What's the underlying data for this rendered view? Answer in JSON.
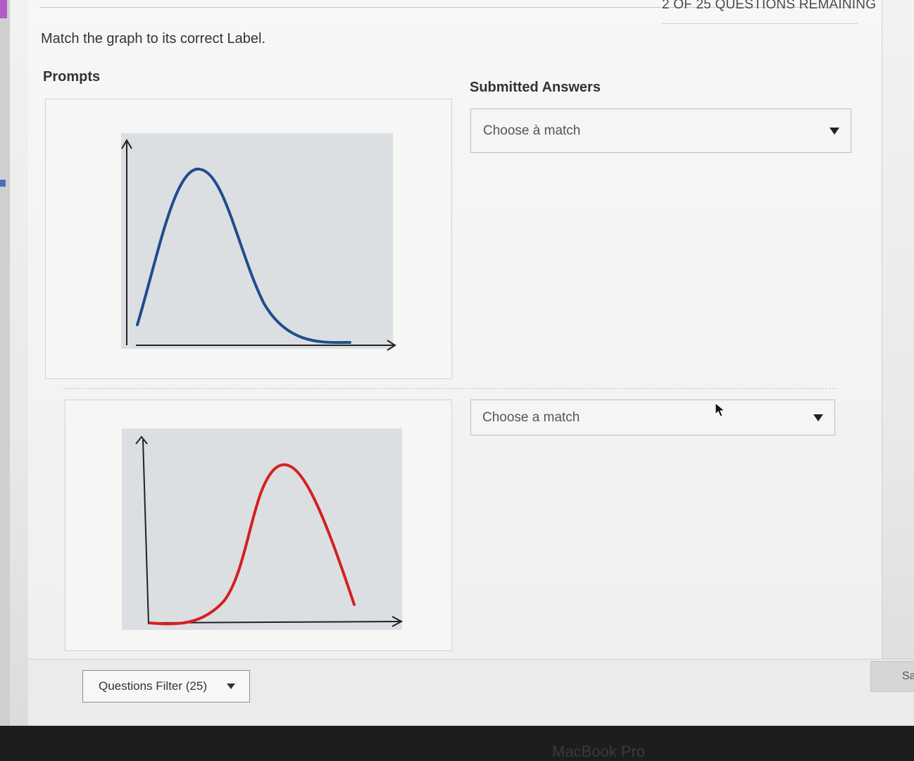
{
  "header": {
    "remaining": "2 OF 25 QUESTIONS REMAINING"
  },
  "question": {
    "instruction": "Match the graph to its correct Label."
  },
  "columns": {
    "prompts": "Prompts",
    "answers": "Submitted Answers"
  },
  "answers": [
    {
      "placeholder": "Choose à match"
    },
    {
      "placeholder": "Choose a match"
    }
  ],
  "graphs": [
    {
      "curve_color": "#1f4e8c",
      "shape": "right-skewed peak"
    },
    {
      "curve_color": "#d32121",
      "shape": "left-skewed peak"
    }
  ],
  "footer": {
    "filter_label": "Questions Filter (25)",
    "save_label": "Sa"
  },
  "device": {
    "label": "MacBook Pro"
  }
}
